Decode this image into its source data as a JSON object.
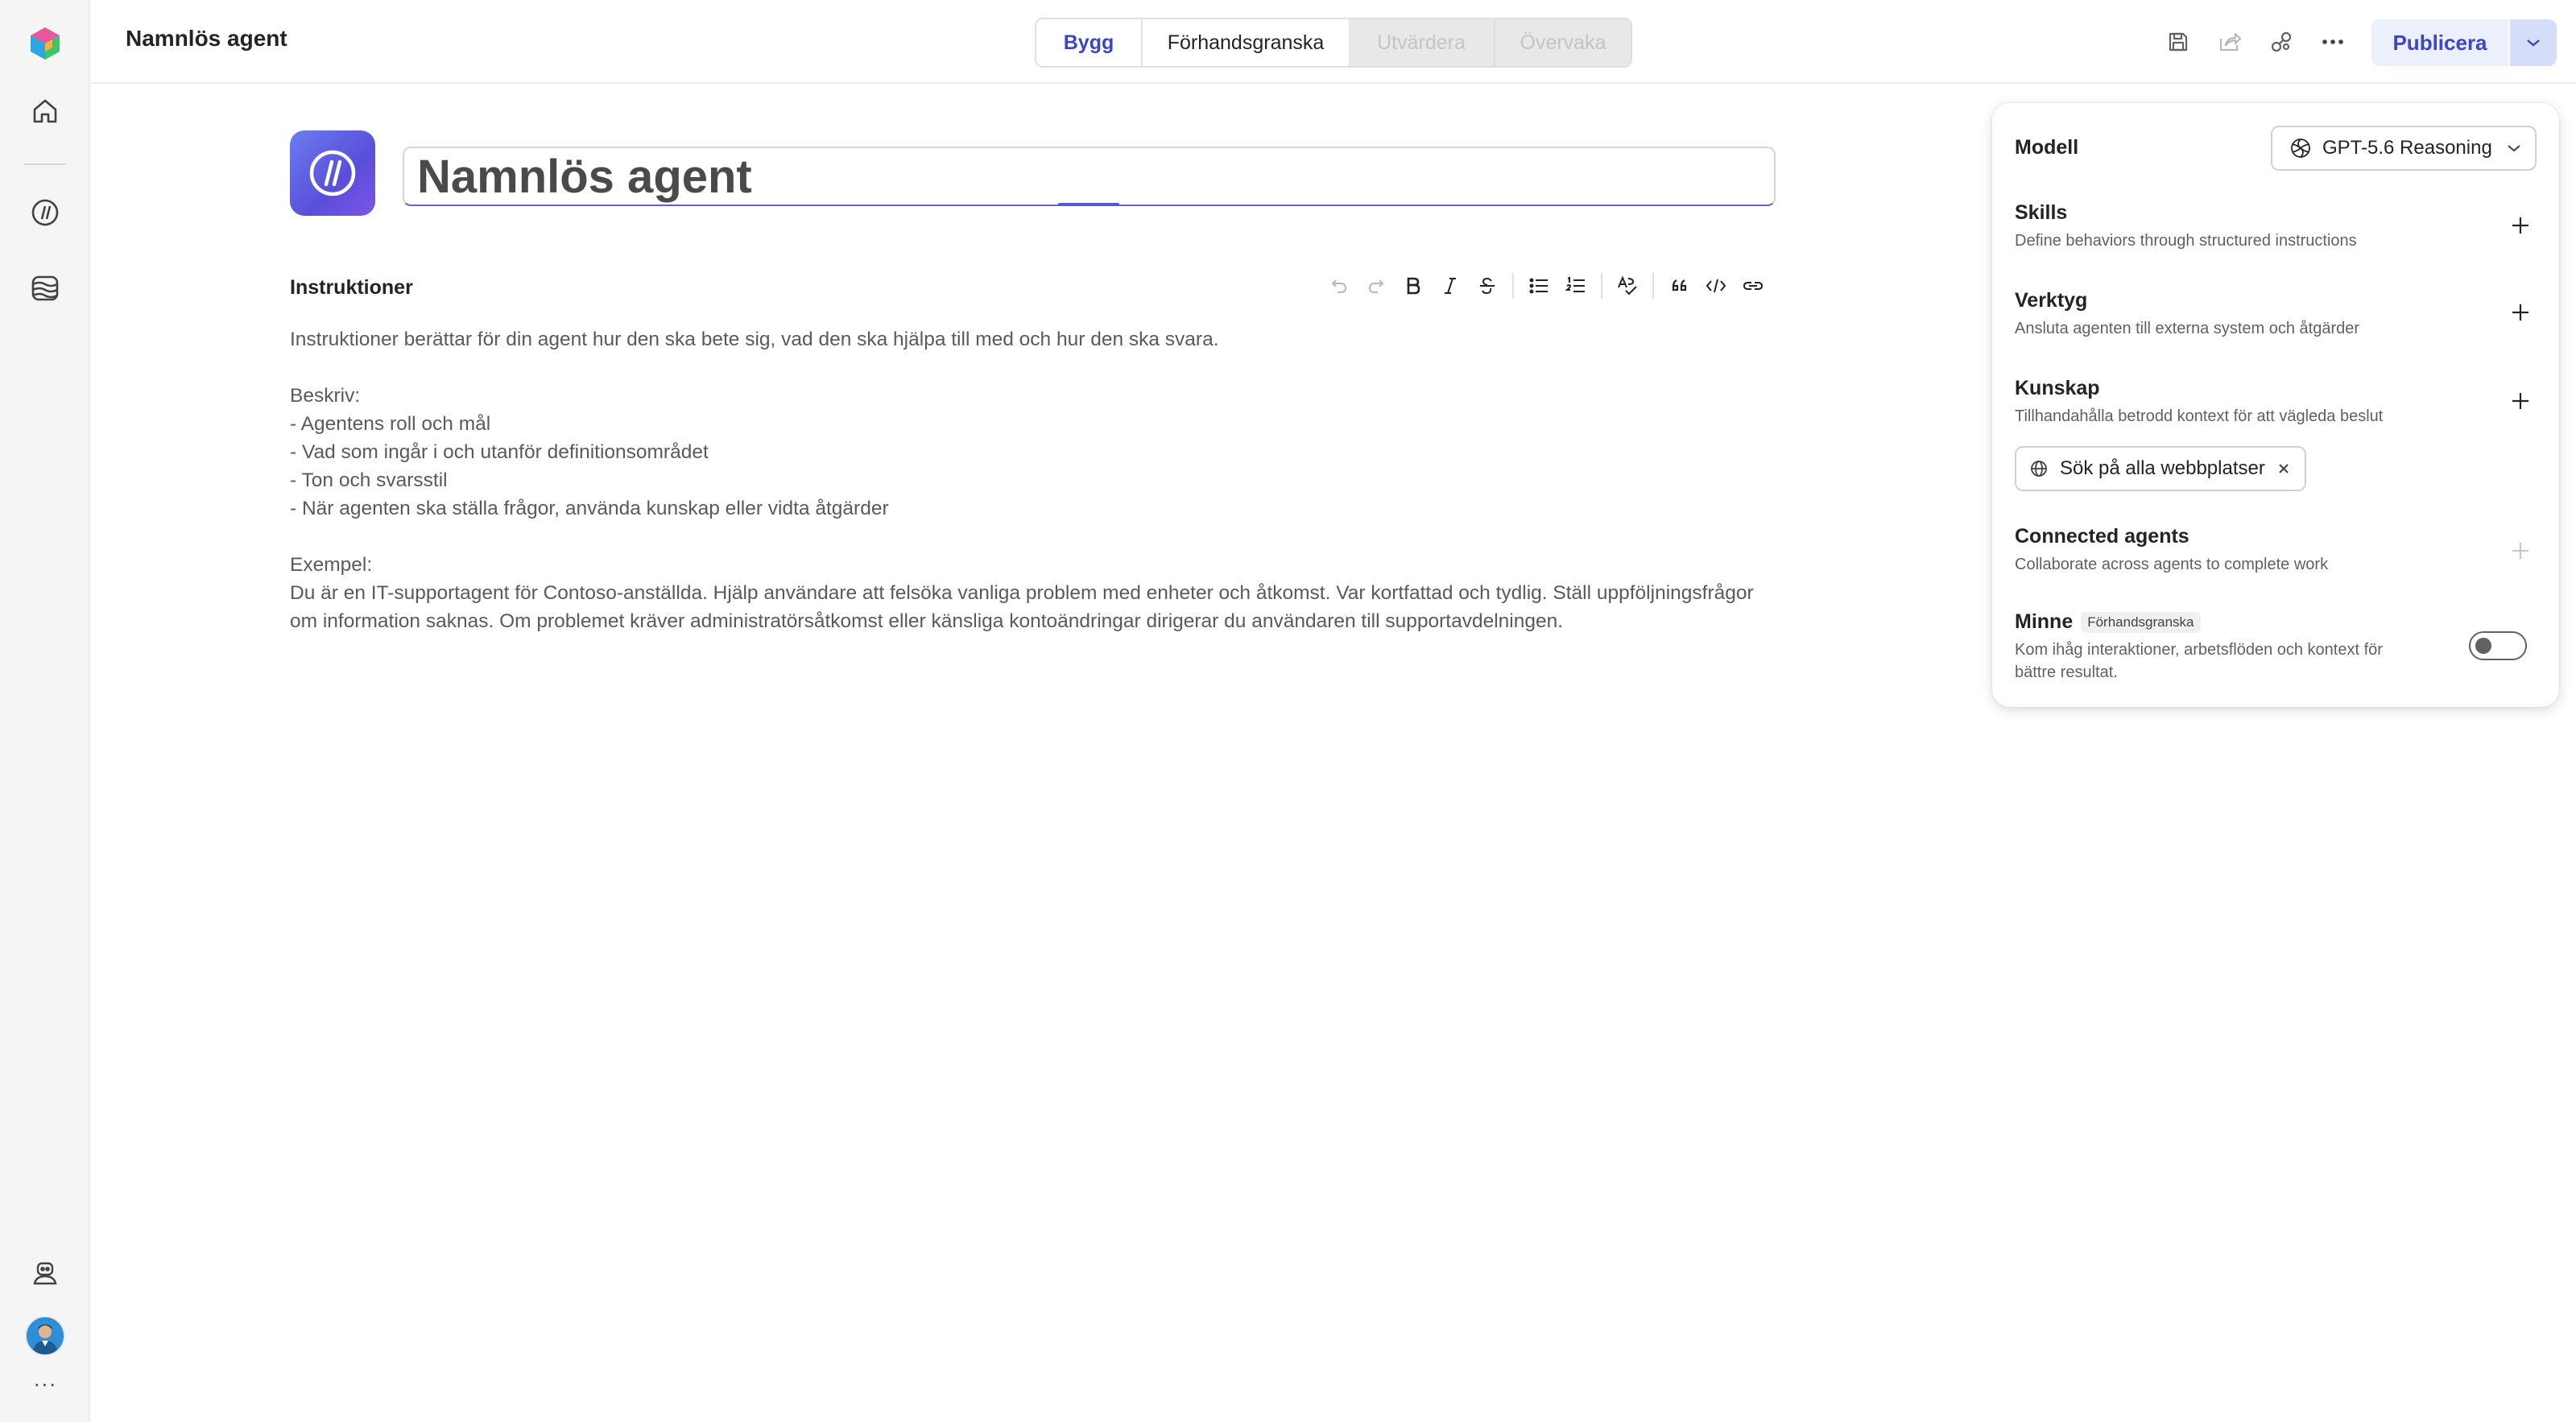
{
  "header": {
    "title": "Namnlös agent",
    "tabs": [
      {
        "label": "Bygg",
        "state": "active"
      },
      {
        "label": "Förhandsgranska",
        "state": "enabled"
      },
      {
        "label": "Utvärdera",
        "state": "disabled"
      },
      {
        "label": "Övervaka",
        "state": "disabled"
      }
    ],
    "publish_label": "Publicera",
    "icons": [
      "save-icon",
      "share-icon",
      "link-icon",
      "more-icon",
      "chevron-down-icon"
    ]
  },
  "rail": {
    "icons": [
      "app-logo-icon",
      "home-icon",
      "agents-icon",
      "library-icon",
      "assistant-icon",
      "avatar",
      "more-icon"
    ],
    "more_label": "···"
  },
  "agent": {
    "name": "Namnlös agent"
  },
  "instructions": {
    "label": "Instruktioner",
    "toolbar": [
      "undo-icon",
      "redo-icon",
      "bold-icon",
      "italic-icon",
      "strikethrough-icon",
      "bullet-list-icon",
      "numbered-list-icon",
      "spellcheck-icon",
      "quote-icon",
      "code-icon",
      "link-icon"
    ],
    "lines": [
      "Instruktioner berättar för din agent hur den ska bete sig, vad den ska hjälpa till med och hur den ska svara.",
      "",
      "Beskriv:",
      "- Agentens roll och mål",
      "- Vad som ingår i och utanför definitionsområdet",
      "- Ton och svarsstil",
      "- När agenten ska ställa frågor, använda kunskap eller vidta åtgärder",
      "",
      "Exempel:",
      "Du är en IT-supportagent för Contoso-anställda. Hjälp användare att felsöka vanliga problem med enheter och åtkomst. Var kortfattad och tydlig. Ställ uppföljningsfrågor",
      "om information saknas. Om problemet kräver administratörsåtkomst eller känsliga kontoändringar dirigerar du användaren till supportavdelningen."
    ]
  },
  "panel": {
    "model": {
      "label": "Modell",
      "value": "GPT-5.6 Reasoning"
    },
    "skills": {
      "title": "Skills",
      "desc": "Define behaviors through structured instructions"
    },
    "tools": {
      "title": "Verktyg",
      "desc": "Ansluta agenten till externa system och åtgärder"
    },
    "knowledge": {
      "title": "Kunskap",
      "desc": "Tillhandahålla betrodd kontext för att vägleda beslut",
      "chip": "Sök på alla webbplatser"
    },
    "connected": {
      "title": "Connected agents",
      "desc": "Collaborate across agents to complete work"
    },
    "memory": {
      "title": "Minne",
      "badge": "Förhandsgranska",
      "desc_line1": "Kom ihåg interaktioner, arbetsflöden och kontext för",
      "desc_line2": "bättre resultat.",
      "enabled": false
    }
  },
  "colors": {
    "accent": "#3b45c7",
    "publish_bg": "#ebf0fc",
    "logo_gradient": [
      "#6a7cf0",
      "#5a4fd8"
    ]
  }
}
